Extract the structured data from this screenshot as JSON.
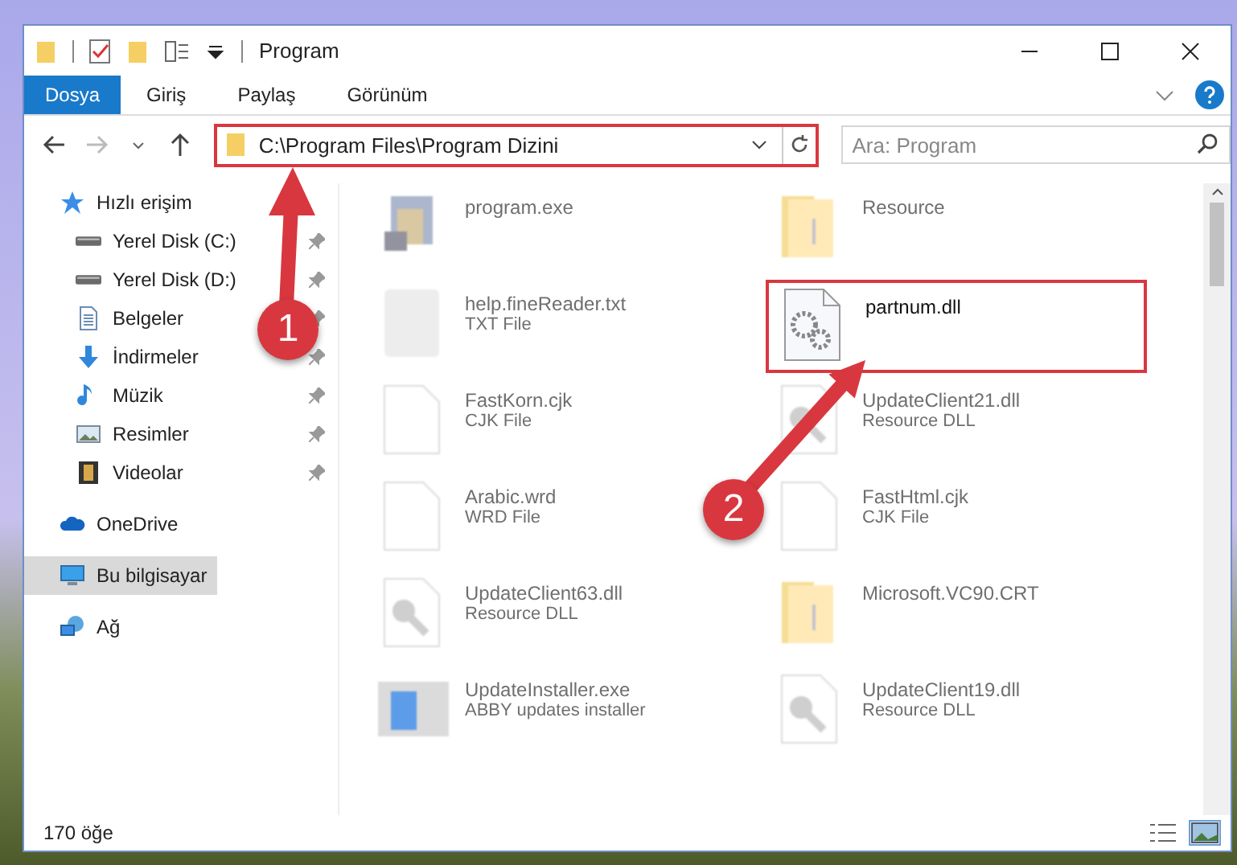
{
  "window": {
    "title": "Program"
  },
  "ribbon_tabs": [
    {
      "label": "Dosya",
      "selected": true
    },
    {
      "label": "Giriş",
      "selected": false
    },
    {
      "label": "Paylaş",
      "selected": false
    },
    {
      "label": "Görünüm",
      "selected": false
    }
  ],
  "address": {
    "path": "C:\\Program Files\\Program Dizini",
    "highlighted": true
  },
  "search": {
    "placeholder": "Ara: Program"
  },
  "sidebar": {
    "items": [
      {
        "label": "Hızlı erişim",
        "kind": "star",
        "selected": false,
        "children": [
          {
            "label": "Yerel Disk (C:)",
            "kind": "drive",
            "pinned": true,
            "selected": false
          },
          {
            "label": "Yerel Disk (D:)",
            "kind": "drive",
            "pinned": true,
            "selected": false
          },
          {
            "label": "Belgeler",
            "kind": "document",
            "pinned": true,
            "selected": false
          },
          {
            "label": "İndirmeler",
            "kind": "download",
            "pinned": true,
            "selected": false
          },
          {
            "label": "Müzik",
            "kind": "music",
            "pinned": true,
            "selected": false
          },
          {
            "label": "Resimler",
            "kind": "picture",
            "pinned": true,
            "selected": false
          },
          {
            "label": "Videolar",
            "kind": "video",
            "pinned": true,
            "selected": false
          }
        ]
      },
      {
        "label": "OneDrive",
        "kind": "cloud",
        "selected": false
      },
      {
        "label": "Bu bilgisayar",
        "kind": "computer",
        "selected": true
      },
      {
        "label": "Ağ",
        "kind": "network",
        "selected": false
      }
    ]
  },
  "files": [
    {
      "name": "program.exe",
      "kind": "exe",
      "blurred": true,
      "highlighted": false
    },
    {
      "name": "Resource",
      "kind": "folder",
      "blurred": true,
      "highlighted": false
    },
    {
      "name": "help.fineReader.txt",
      "type": "TXT File",
      "kind": "txt",
      "blurred": true,
      "highlighted": false
    },
    {
      "name": "partnum.dll",
      "kind": "dll",
      "blurred": false,
      "highlighted": true
    },
    {
      "name": "FastKorn.cjk",
      "type": "CJK File",
      "kind": "doc",
      "blurred": true,
      "highlighted": false
    },
    {
      "name": "UpdateClient21.dll",
      "type": "Resource DLL",
      "kind": "resdll",
      "blurred": true,
      "highlighted": false
    },
    {
      "name": "Arabic.wrd",
      "type": "WRD File",
      "kind": "doc",
      "blurred": true,
      "highlighted": false
    },
    {
      "name": "FastHtml.cjk",
      "type": "CJK File",
      "kind": "doc",
      "blurred": true,
      "highlighted": false
    },
    {
      "name": "UpdateClient63.dll",
      "type": "Resource DLL",
      "kind": "resdll",
      "blurred": true,
      "highlighted": false
    },
    {
      "name": "Microsoft.VC90.CRT",
      "kind": "folder",
      "blurred": true,
      "highlighted": false
    },
    {
      "name": "UpdateInstaller.exe",
      "type": "ABBY updates installer",
      "kind": "installer",
      "blurred": true,
      "highlighted": false
    },
    {
      "name": "UpdateClient19.dll",
      "type": "Resource DLL",
      "kind": "resdll",
      "blurred": true,
      "highlighted": false
    }
  ],
  "annotations": [
    {
      "number": "1"
    },
    {
      "number": "2"
    }
  ],
  "status_bar": {
    "item_count": "170 öğe"
  },
  "view_buttons": [
    {
      "kind": "details",
      "selected": false
    },
    {
      "kind": "large_icons",
      "selected": true
    }
  ]
}
